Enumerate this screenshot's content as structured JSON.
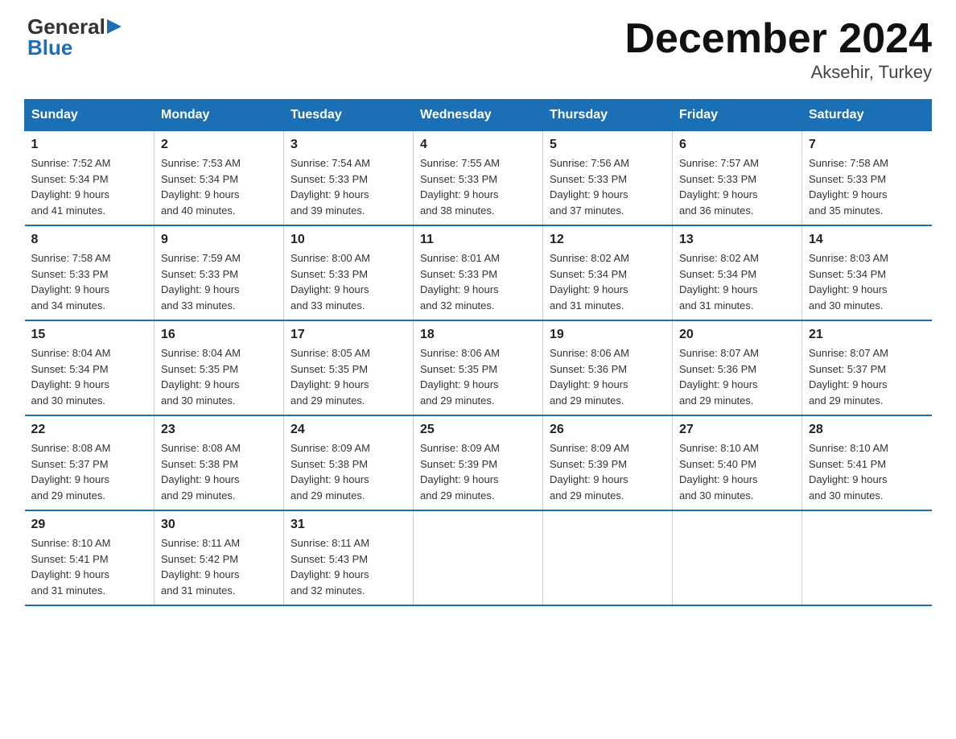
{
  "logo": {
    "general": "General",
    "blue": "Blue",
    "arrow_symbol": "▶"
  },
  "title": "December 2024",
  "subtitle": "Aksehir, Turkey",
  "days_of_week": [
    "Sunday",
    "Monday",
    "Tuesday",
    "Wednesday",
    "Thursday",
    "Friday",
    "Saturday"
  ],
  "weeks": [
    [
      {
        "day": "1",
        "sunrise": "7:52 AM",
        "sunset": "5:34 PM",
        "daylight": "9 hours and 41 minutes."
      },
      {
        "day": "2",
        "sunrise": "7:53 AM",
        "sunset": "5:34 PM",
        "daylight": "9 hours and 40 minutes."
      },
      {
        "day": "3",
        "sunrise": "7:54 AM",
        "sunset": "5:33 PM",
        "daylight": "9 hours and 39 minutes."
      },
      {
        "day": "4",
        "sunrise": "7:55 AM",
        "sunset": "5:33 PM",
        "daylight": "9 hours and 38 minutes."
      },
      {
        "day": "5",
        "sunrise": "7:56 AM",
        "sunset": "5:33 PM",
        "daylight": "9 hours and 37 minutes."
      },
      {
        "day": "6",
        "sunrise": "7:57 AM",
        "sunset": "5:33 PM",
        "daylight": "9 hours and 36 minutes."
      },
      {
        "day": "7",
        "sunrise": "7:58 AM",
        "sunset": "5:33 PM",
        "daylight": "9 hours and 35 minutes."
      }
    ],
    [
      {
        "day": "8",
        "sunrise": "7:58 AM",
        "sunset": "5:33 PM",
        "daylight": "9 hours and 34 minutes."
      },
      {
        "day": "9",
        "sunrise": "7:59 AM",
        "sunset": "5:33 PM",
        "daylight": "9 hours and 33 minutes."
      },
      {
        "day": "10",
        "sunrise": "8:00 AM",
        "sunset": "5:33 PM",
        "daylight": "9 hours and 33 minutes."
      },
      {
        "day": "11",
        "sunrise": "8:01 AM",
        "sunset": "5:33 PM",
        "daylight": "9 hours and 32 minutes."
      },
      {
        "day": "12",
        "sunrise": "8:02 AM",
        "sunset": "5:34 PM",
        "daylight": "9 hours and 31 minutes."
      },
      {
        "day": "13",
        "sunrise": "8:02 AM",
        "sunset": "5:34 PM",
        "daylight": "9 hours and 31 minutes."
      },
      {
        "day": "14",
        "sunrise": "8:03 AM",
        "sunset": "5:34 PM",
        "daylight": "9 hours and 30 minutes."
      }
    ],
    [
      {
        "day": "15",
        "sunrise": "8:04 AM",
        "sunset": "5:34 PM",
        "daylight": "9 hours and 30 minutes."
      },
      {
        "day": "16",
        "sunrise": "8:04 AM",
        "sunset": "5:35 PM",
        "daylight": "9 hours and 30 minutes."
      },
      {
        "day": "17",
        "sunrise": "8:05 AM",
        "sunset": "5:35 PM",
        "daylight": "9 hours and 29 minutes."
      },
      {
        "day": "18",
        "sunrise": "8:06 AM",
        "sunset": "5:35 PM",
        "daylight": "9 hours and 29 minutes."
      },
      {
        "day": "19",
        "sunrise": "8:06 AM",
        "sunset": "5:36 PM",
        "daylight": "9 hours and 29 minutes."
      },
      {
        "day": "20",
        "sunrise": "8:07 AM",
        "sunset": "5:36 PM",
        "daylight": "9 hours and 29 minutes."
      },
      {
        "day": "21",
        "sunrise": "8:07 AM",
        "sunset": "5:37 PM",
        "daylight": "9 hours and 29 minutes."
      }
    ],
    [
      {
        "day": "22",
        "sunrise": "8:08 AM",
        "sunset": "5:37 PM",
        "daylight": "9 hours and 29 minutes."
      },
      {
        "day": "23",
        "sunrise": "8:08 AM",
        "sunset": "5:38 PM",
        "daylight": "9 hours and 29 minutes."
      },
      {
        "day": "24",
        "sunrise": "8:09 AM",
        "sunset": "5:38 PM",
        "daylight": "9 hours and 29 minutes."
      },
      {
        "day": "25",
        "sunrise": "8:09 AM",
        "sunset": "5:39 PM",
        "daylight": "9 hours and 29 minutes."
      },
      {
        "day": "26",
        "sunrise": "8:09 AM",
        "sunset": "5:39 PM",
        "daylight": "9 hours and 29 minutes."
      },
      {
        "day": "27",
        "sunrise": "8:10 AM",
        "sunset": "5:40 PM",
        "daylight": "9 hours and 30 minutes."
      },
      {
        "day": "28",
        "sunrise": "8:10 AM",
        "sunset": "5:41 PM",
        "daylight": "9 hours and 30 minutes."
      }
    ],
    [
      {
        "day": "29",
        "sunrise": "8:10 AM",
        "sunset": "5:41 PM",
        "daylight": "9 hours and 31 minutes."
      },
      {
        "day": "30",
        "sunrise": "8:11 AM",
        "sunset": "5:42 PM",
        "daylight": "9 hours and 31 minutes."
      },
      {
        "day": "31",
        "sunrise": "8:11 AM",
        "sunset": "5:43 PM",
        "daylight": "9 hours and 32 minutes."
      },
      null,
      null,
      null,
      null
    ]
  ],
  "labels": {
    "sunrise": "Sunrise:",
    "sunset": "Sunset:",
    "daylight": "Daylight:"
  }
}
